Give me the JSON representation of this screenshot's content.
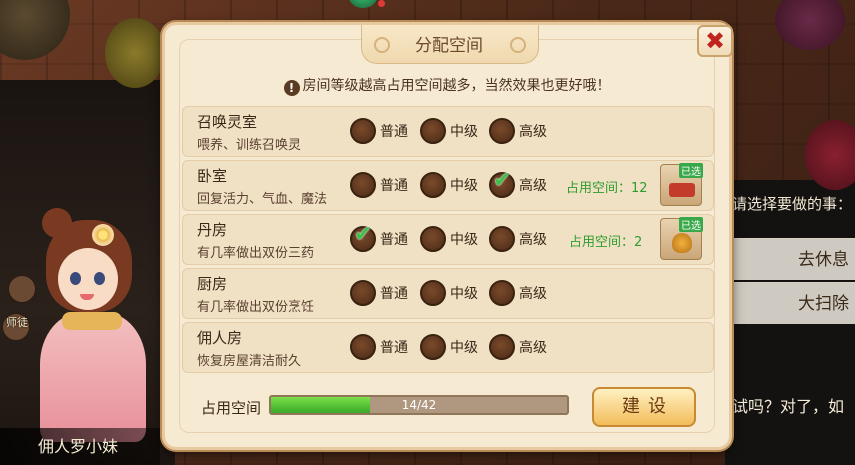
{
  "panel": {
    "title": "分配空间",
    "notice": "房间等级越高占用空间越多，当然效果也更好哦！",
    "close_symbol": "✖"
  },
  "levels": [
    "普通",
    "中级",
    "高级"
  ],
  "rooms": [
    {
      "name": "召唤灵室",
      "desc": "喂养、训练召唤灵",
      "selected": null,
      "occupy": ""
    },
    {
      "name": "卧室",
      "desc": "回复活力、气血、魔法",
      "selected": 2,
      "occupy": "占用空间：12",
      "used_tag": "已选",
      "icon": "bed-icon"
    },
    {
      "name": "丹房",
      "desc": "有几率做出双份三药",
      "selected": 0,
      "occupy": "占用空间：2",
      "used_tag": "已选",
      "icon": "cauldron-icon"
    },
    {
      "name": "厨房",
      "desc": "有几率做出双份烹饪",
      "selected": null,
      "occupy": ""
    },
    {
      "name": "佣人房",
      "desc": "恢复房屋清洁耐久",
      "selected": null,
      "occupy": ""
    }
  ],
  "footer": {
    "progress_label": "占用空间",
    "progress_text": "14/42",
    "progress_value": 14,
    "progress_max": 42,
    "build_button": "建设"
  },
  "background": {
    "npc_name": "佣人罗小妹",
    "mini_label": "师徒",
    "dialog_prompt": "请选择要做的事：",
    "choices": [
      "去休息",
      "大扫除"
    ],
    "dialog_text": "试吗？对了，如"
  },
  "colors": {
    "accent_green": "#3aa828",
    "title_brown": "#6b4a2a",
    "close_red": "#c0241e",
    "button_gold": "#f2bc5a"
  }
}
